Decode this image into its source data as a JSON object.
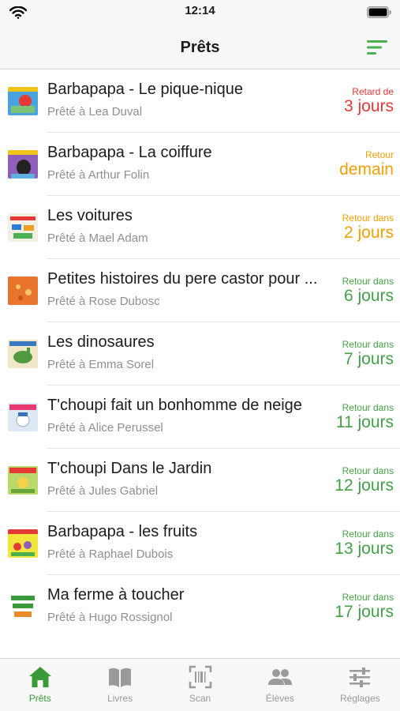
{
  "status_bar": {
    "time": "12:14"
  },
  "nav": {
    "title": "Prêts"
  },
  "colors": {
    "overdue": "#e53935",
    "soon": "#f5a000",
    "ok": "#43a047",
    "accent": "#4caf50"
  },
  "loans": [
    {
      "title": "Barbapapa - Le pique-nique",
      "borrower": "Prêté à Lea Duval",
      "due_label": "Retard de",
      "due_value": "3 jours",
      "status": "overdue"
    },
    {
      "title": "Barbapapa - La coiffure",
      "borrower": "Prêté à Arthur Folin",
      "due_label": "Retour",
      "due_value": "demain",
      "status": "soon"
    },
    {
      "title": "Les voitures",
      "borrower": "Prêté à Mael Adam",
      "due_label": "Retour dans",
      "due_value": "2 jours",
      "status": "soon"
    },
    {
      "title": "Petites histoires du pere castor pour ...",
      "borrower": "Prêté à Rose Dubosc",
      "due_label": "Retour dans",
      "due_value": "6 jours",
      "status": "ok"
    },
    {
      "title": "Les dinosaures",
      "borrower": "Prêté à Emma Sorel",
      "due_label": "Retour dans",
      "due_value": "7 jours",
      "status": "ok"
    },
    {
      "title": "T'choupi fait un bonhomme de neige",
      "borrower": "Prêté à Alice Perussel",
      "due_label": "Retour dans",
      "due_value": "11 jours",
      "status": "ok"
    },
    {
      "title": "T'choupi Dans le Jardin",
      "borrower": "Prêté à Jules Gabriel",
      "due_label": "Retour dans",
      "due_value": "12 jours",
      "status": "ok"
    },
    {
      "title": "Barbapapa - les fruits",
      "borrower": "Prêté à Raphael Dubois",
      "due_label": "Retour dans",
      "due_value": "13 jours",
      "status": "ok"
    },
    {
      "title": "Ma ferme à toucher",
      "borrower": "Prêté à Hugo Rossignol",
      "due_label": "Retour dans",
      "due_value": "17 jours",
      "status": "ok"
    }
  ],
  "tabs": [
    {
      "label": "Prêts",
      "icon": "home-icon",
      "active": true
    },
    {
      "label": "Livres",
      "icon": "book-icon",
      "active": false
    },
    {
      "label": "Scan",
      "icon": "barcode-scan-icon",
      "active": false
    },
    {
      "label": "Élèves",
      "icon": "people-icon",
      "active": false
    },
    {
      "label": "Réglages",
      "icon": "sliders-icon",
      "active": false
    }
  ]
}
